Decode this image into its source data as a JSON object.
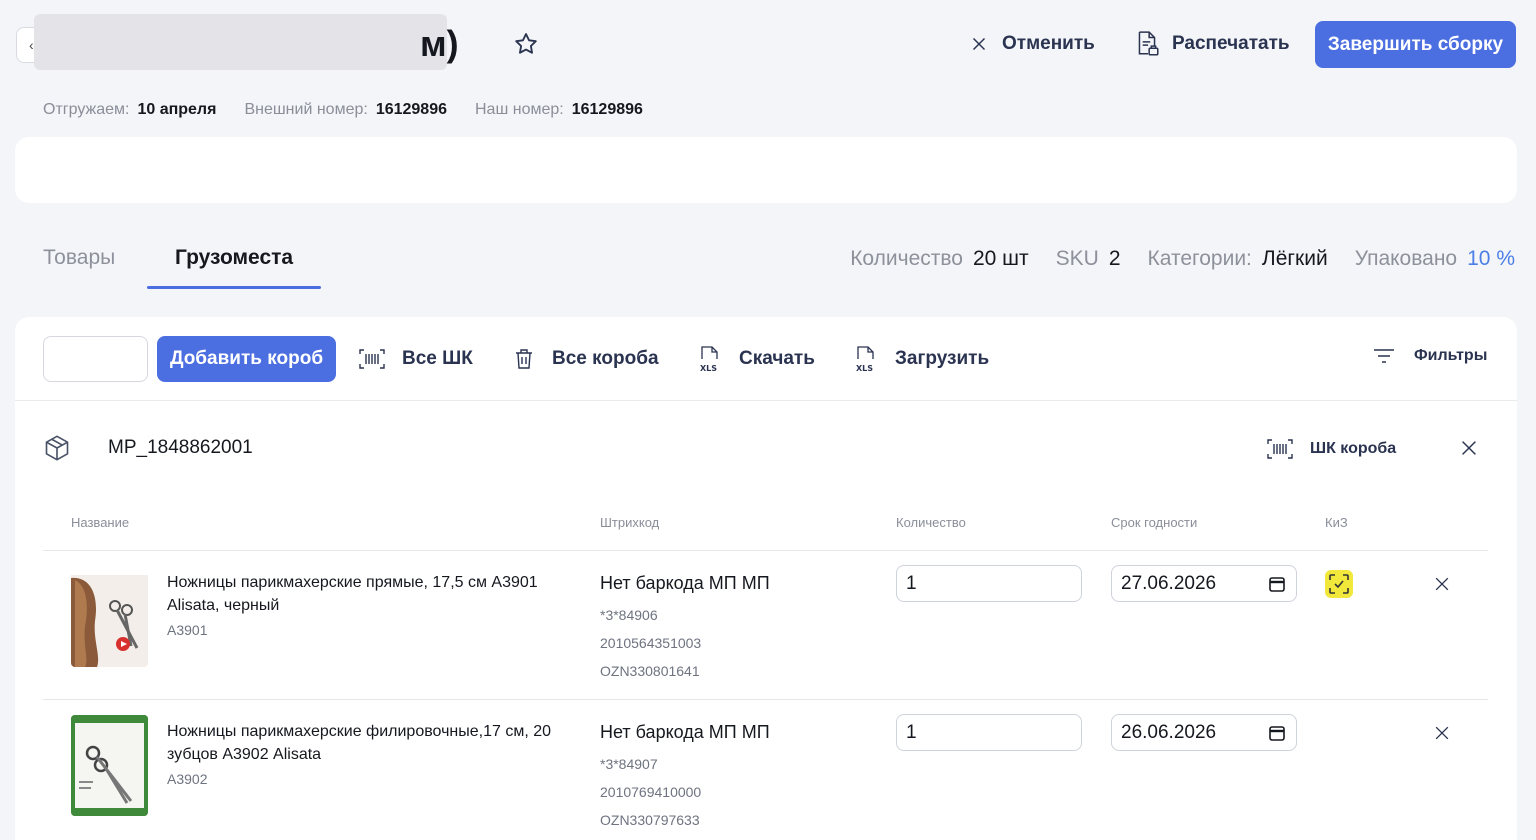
{
  "header": {
    "title_tail": "м)",
    "cancel_label": "Отменить",
    "print_label": "Распечатать",
    "finish_label": "Завершить сборку"
  },
  "meta": [
    {
      "label": "Отгружаем:",
      "value": "10 апреля"
    },
    {
      "label": "Внешний номер:",
      "value": "16129896"
    },
    {
      "label": "Наш номер:",
      "value": "16129896"
    }
  ],
  "tabs": [
    {
      "label": "Товары"
    },
    {
      "label": "Грузоместа"
    }
  ],
  "stats": {
    "qty_label": "Количество",
    "qty_value": "20 шт",
    "sku_label": "SKU",
    "sku_value": "2",
    "cat_label": "Категории:",
    "cat_value": "Лёгкий",
    "packed_label": "Упаковано",
    "packed_value": "10 %"
  },
  "toolbar": {
    "add_box_label": "Добавить короб",
    "all_barcodes_label": "Все ШК",
    "all_boxes_label": "Все короба",
    "download_label": "Скачать",
    "upload_label": "Загрузить",
    "filters_label": "Фильтры"
  },
  "box": {
    "id": "MP_1848862001",
    "barcode_label": "ШК короба"
  },
  "table": {
    "headers": {
      "name": "Название",
      "barcode": "Штрихкод",
      "qty": "Количество",
      "expiry": "Срок годности",
      "kiz": "КиЗ"
    },
    "rows": [
      {
        "name": "Ножницы парикмахерские прямые, 17,5 см А3901 Alisata, черный",
        "sku": "А3901",
        "barcode_main": "Нет баркода МП МП",
        "barcode_lines": [
          "*3*84906",
          "2010564351003",
          "OZN330801641"
        ],
        "qty": "1",
        "expiry": "27.06.2026",
        "kiz": true
      },
      {
        "name": "Ножницы парикмахерские филировочные,17 см, 20 зубцов А3902 Alisata",
        "sku": "А3902",
        "barcode_main": "Нет баркода МП МП",
        "barcode_lines": [
          "*3*84907",
          "2010769410000",
          "OZN330797633"
        ],
        "qty": "1",
        "expiry": "26.06.2026",
        "kiz": false
      }
    ]
  },
  "colors": {
    "accent": "#4b6ee0",
    "packed": "#4b7fe6",
    "kiz_badge": "#f2e83c"
  }
}
